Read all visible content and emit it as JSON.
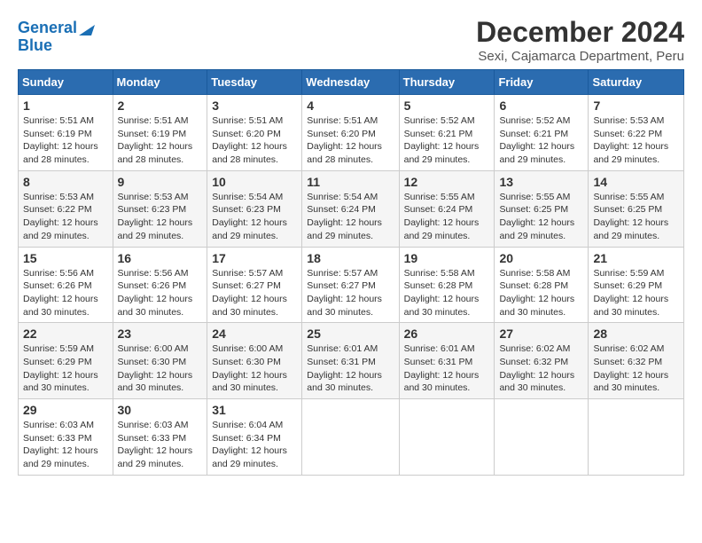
{
  "logo": {
    "line1": "General",
    "line2": "Blue"
  },
  "title": "December 2024",
  "subtitle": "Sexi, Cajamarca Department, Peru",
  "days_of_week": [
    "Sunday",
    "Monday",
    "Tuesday",
    "Wednesday",
    "Thursday",
    "Friday",
    "Saturday"
  ],
  "weeks": [
    [
      {
        "day": "1",
        "sunrise": "5:51 AM",
        "sunset": "6:19 PM",
        "daylight": "12 hours and 28 minutes."
      },
      {
        "day": "2",
        "sunrise": "5:51 AM",
        "sunset": "6:19 PM",
        "daylight": "12 hours and 28 minutes."
      },
      {
        "day": "3",
        "sunrise": "5:51 AM",
        "sunset": "6:20 PM",
        "daylight": "12 hours and 28 minutes."
      },
      {
        "day": "4",
        "sunrise": "5:51 AM",
        "sunset": "6:20 PM",
        "daylight": "12 hours and 28 minutes."
      },
      {
        "day": "5",
        "sunrise": "5:52 AM",
        "sunset": "6:21 PM",
        "daylight": "12 hours and 29 minutes."
      },
      {
        "day": "6",
        "sunrise": "5:52 AM",
        "sunset": "6:21 PM",
        "daylight": "12 hours and 29 minutes."
      },
      {
        "day": "7",
        "sunrise": "5:53 AM",
        "sunset": "6:22 PM",
        "daylight": "12 hours and 29 minutes."
      }
    ],
    [
      {
        "day": "8",
        "sunrise": "5:53 AM",
        "sunset": "6:22 PM",
        "daylight": "12 hours and 29 minutes."
      },
      {
        "day": "9",
        "sunrise": "5:53 AM",
        "sunset": "6:23 PM",
        "daylight": "12 hours and 29 minutes."
      },
      {
        "day": "10",
        "sunrise": "5:54 AM",
        "sunset": "6:23 PM",
        "daylight": "12 hours and 29 minutes."
      },
      {
        "day": "11",
        "sunrise": "5:54 AM",
        "sunset": "6:24 PM",
        "daylight": "12 hours and 29 minutes."
      },
      {
        "day": "12",
        "sunrise": "5:55 AM",
        "sunset": "6:24 PM",
        "daylight": "12 hours and 29 minutes."
      },
      {
        "day": "13",
        "sunrise": "5:55 AM",
        "sunset": "6:25 PM",
        "daylight": "12 hours and 29 minutes."
      },
      {
        "day": "14",
        "sunrise": "5:55 AM",
        "sunset": "6:25 PM",
        "daylight": "12 hours and 29 minutes."
      }
    ],
    [
      {
        "day": "15",
        "sunrise": "5:56 AM",
        "sunset": "6:26 PM",
        "daylight": "12 hours and 30 minutes."
      },
      {
        "day": "16",
        "sunrise": "5:56 AM",
        "sunset": "6:26 PM",
        "daylight": "12 hours and 30 minutes."
      },
      {
        "day": "17",
        "sunrise": "5:57 AM",
        "sunset": "6:27 PM",
        "daylight": "12 hours and 30 minutes."
      },
      {
        "day": "18",
        "sunrise": "5:57 AM",
        "sunset": "6:27 PM",
        "daylight": "12 hours and 30 minutes."
      },
      {
        "day": "19",
        "sunrise": "5:58 AM",
        "sunset": "6:28 PM",
        "daylight": "12 hours and 30 minutes."
      },
      {
        "day": "20",
        "sunrise": "5:58 AM",
        "sunset": "6:28 PM",
        "daylight": "12 hours and 30 minutes."
      },
      {
        "day": "21",
        "sunrise": "5:59 AM",
        "sunset": "6:29 PM",
        "daylight": "12 hours and 30 minutes."
      }
    ],
    [
      {
        "day": "22",
        "sunrise": "5:59 AM",
        "sunset": "6:29 PM",
        "daylight": "12 hours and 30 minutes."
      },
      {
        "day": "23",
        "sunrise": "6:00 AM",
        "sunset": "6:30 PM",
        "daylight": "12 hours and 30 minutes."
      },
      {
        "day": "24",
        "sunrise": "6:00 AM",
        "sunset": "6:30 PM",
        "daylight": "12 hours and 30 minutes."
      },
      {
        "day": "25",
        "sunrise": "6:01 AM",
        "sunset": "6:31 PM",
        "daylight": "12 hours and 30 minutes."
      },
      {
        "day": "26",
        "sunrise": "6:01 AM",
        "sunset": "6:31 PM",
        "daylight": "12 hours and 30 minutes."
      },
      {
        "day": "27",
        "sunrise": "6:02 AM",
        "sunset": "6:32 PM",
        "daylight": "12 hours and 30 minutes."
      },
      {
        "day": "28",
        "sunrise": "6:02 AM",
        "sunset": "6:32 PM",
        "daylight": "12 hours and 30 minutes."
      }
    ],
    [
      {
        "day": "29",
        "sunrise": "6:03 AM",
        "sunset": "6:33 PM",
        "daylight": "12 hours and 29 minutes."
      },
      {
        "day": "30",
        "sunrise": "6:03 AM",
        "sunset": "6:33 PM",
        "daylight": "12 hours and 29 minutes."
      },
      {
        "day": "31",
        "sunrise": "6:04 AM",
        "sunset": "6:34 PM",
        "daylight": "12 hours and 29 minutes."
      },
      null,
      null,
      null,
      null
    ]
  ]
}
